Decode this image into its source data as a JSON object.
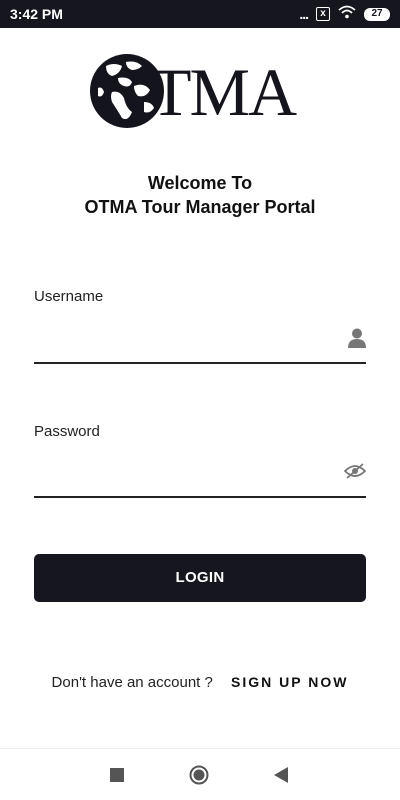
{
  "status_bar": {
    "time": "3:42 PM",
    "dots": "...",
    "sim_label": "x",
    "battery": "27",
    "icons": [
      "more-dots-icon",
      "sim-x-icon",
      "wifi-icon",
      "battery-icon"
    ],
    "background": "#16161e"
  },
  "logo": {
    "text": "TMA",
    "icon": "globe-icon"
  },
  "heading": {
    "line1": "Welcome To",
    "line2": "OTMA Tour Manager Portal"
  },
  "form": {
    "username": {
      "label": "Username",
      "value": "",
      "icon": "user-icon"
    },
    "password": {
      "label": "Password",
      "value": "",
      "icon": "eye-off-icon"
    },
    "login_label": "LOGIN"
  },
  "signup": {
    "prompt": "Don't have an account ?",
    "link_label": "SIGN UP NOW"
  },
  "nav_bar": {
    "icons": [
      "recents-square-icon",
      "home-circle-icon",
      "back-triangle-icon"
    ]
  },
  "colors": {
    "primary": "#16161e",
    "text": "#111111",
    "icon_gray": "#777777"
  }
}
